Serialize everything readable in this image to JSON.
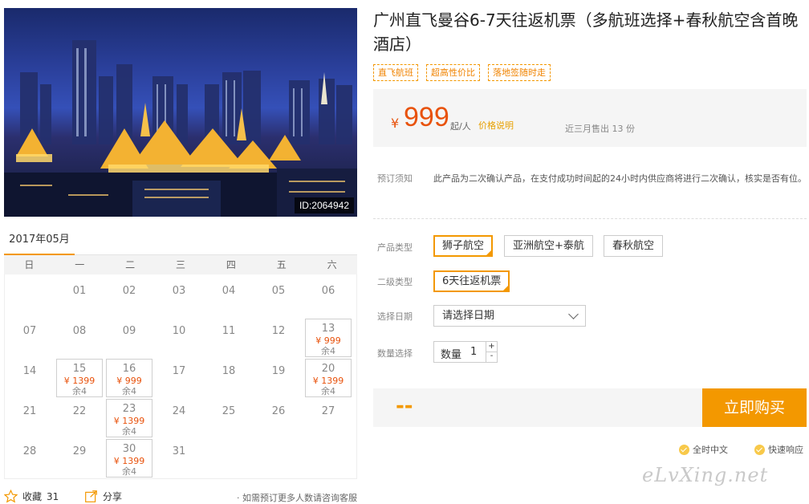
{
  "hero": {
    "image_id": "ID:2064942"
  },
  "calendar": {
    "month": "2017年05月",
    "weekdays": [
      "日",
      "一",
      "二",
      "三",
      "四",
      "五",
      "六"
    ],
    "days": [
      {
        "day": "01"
      },
      {
        "day": "02"
      },
      {
        "day": "03"
      },
      {
        "day": "04"
      },
      {
        "day": "05"
      },
      {
        "day": "06"
      },
      {
        "day": "07"
      },
      {
        "day": "08"
      },
      {
        "day": "09"
      },
      {
        "day": "10"
      },
      {
        "day": "11"
      },
      {
        "day": "12"
      },
      {
        "day": "13",
        "price": "¥ 999",
        "remain": "余4"
      },
      {
        "day": "14"
      },
      {
        "day": "15",
        "price": "¥ 1399",
        "remain": "余4"
      },
      {
        "day": "16",
        "price": "¥ 999",
        "remain": "余4"
      },
      {
        "day": "17"
      },
      {
        "day": "18"
      },
      {
        "day": "19"
      },
      {
        "day": "20",
        "price": "¥ 1399",
        "remain": "余4"
      },
      {
        "day": "21"
      },
      {
        "day": "22"
      },
      {
        "day": "23",
        "price": "¥ 1399",
        "remain": "余4"
      },
      {
        "day": "24"
      },
      {
        "day": "25"
      },
      {
        "day": "26"
      },
      {
        "day": "27"
      },
      {
        "day": "28"
      },
      {
        "day": "29"
      },
      {
        "day": "30",
        "price": "¥ 1399",
        "remain": "余4"
      },
      {
        "day": "31"
      }
    ],
    "first_weekday_index": 1
  },
  "bottom_bar": {
    "favorite_label": "收藏",
    "favorite_count": "31",
    "share_label": "分享",
    "note": "· 如需预订更多人数请咨询客服"
  },
  "product": {
    "title": "广州直飞曼谷6-7天往返机票（多航班选择+春秋航空含首晚酒店）",
    "tags": [
      "直飞航班",
      "超高性价比",
      "落地签随时走"
    ]
  },
  "price": {
    "currency": "¥",
    "value": "999",
    "unit": "起/人",
    "explain_link": "价格说明",
    "sold": "近三月售出 13 份"
  },
  "booking_notice": {
    "label": "预订须知",
    "text": "此产品为二次确认产品，在支付成功时间起的24小时内供应商将进行二次确认，核实是否有位。"
  },
  "options": {
    "product_type_label": "产品类型",
    "product_types": [
      "狮子航空",
      "亚洲航空+泰航",
      "春秋航空"
    ],
    "sub_type_label": "二级类型",
    "sub_types": [
      "6天往返机票"
    ],
    "date_label": "选择日期",
    "date_placeholder": "请选择日期",
    "qty_label": "数量选择",
    "qty_inner_label": "数量",
    "qty_value": "1",
    "plus": "+",
    "minus": "-"
  },
  "purchase": {
    "total": "--",
    "buy_label": "立即购买",
    "guarantees": [
      "全时中文",
      "快速响应"
    ]
  },
  "watermark": "eLvXing.net",
  "colors": {
    "accent": "#f39800",
    "price": "#e8520c"
  }
}
